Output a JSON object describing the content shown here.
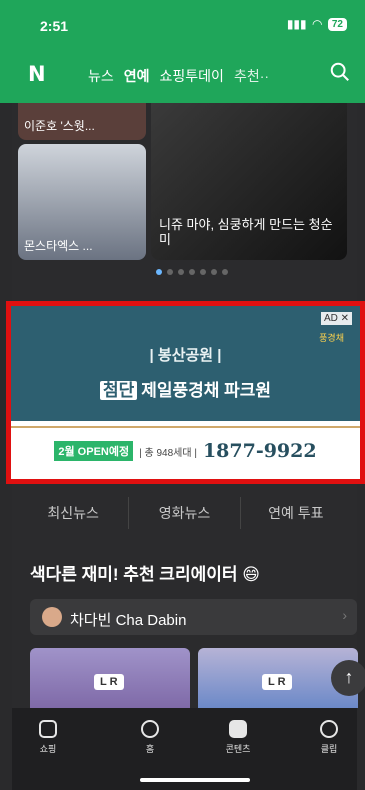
{
  "status": {
    "time": "2:51",
    "battery": "72"
  },
  "header": {
    "logo": "N",
    "tabs": [
      "뉴스",
      "연예",
      "쇼핑투데이",
      "추천··"
    ],
    "active_tab": "연예"
  },
  "cards": [
    {
      "title": "이준호 '스웟..."
    },
    {
      "title": "몬스타엑스 ..."
    },
    {
      "title": "니쥬 마야, 심쿵하게 만드는 청순미"
    }
  ],
  "ad": {
    "badge": "AD ✕",
    "brand": "풍경채",
    "subtitle": "| 봉산공원 |",
    "tag": "첨단",
    "name": "제일풍경채 파크원",
    "open": "2월 OPEN예정",
    "units": "| 총 948세대 |",
    "phone": "1877-9922"
  },
  "subtabs": [
    "최신뉴스",
    "영화뉴스",
    "연예 투표"
  ],
  "section": {
    "title": "색다른 재미! 추천 크리에이터 😄"
  },
  "creator": {
    "name": "차다빈 Cha Dabin"
  },
  "thumbs": [
    {
      "label": "L R"
    },
    {
      "label": "L R"
    }
  ],
  "bottom_nav": [
    "쇼핑",
    "홈",
    "콘텐츠",
    "클립"
  ]
}
